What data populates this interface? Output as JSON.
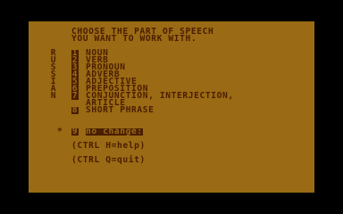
{
  "header": {
    "line1": "CHOOSE THE PART OF SPEECH",
    "line2": "YOU WANT TO WORK WITH."
  },
  "side_letters": [
    "R",
    "U",
    "S",
    "S",
    "I",
    "A",
    "N"
  ],
  "menu": [
    {
      "num": "1",
      "label": "NOUN"
    },
    {
      "num": "2",
      "label": "VERB"
    },
    {
      "num": "3",
      "label": "PRONOUN"
    },
    {
      "num": "4",
      "label": "ADVERB"
    },
    {
      "num": "5",
      "label": "ADJECTIVE"
    },
    {
      "num": "6",
      "label": "PREPOSITION"
    },
    {
      "num": "7",
      "label": "CONJUNCTION, INTERJECTION,",
      "label2": "ARTICLE"
    },
    {
      "num": "8",
      "label": "SHORT PHRASE"
    }
  ],
  "prompt": {
    "marker": "*",
    "num": "9",
    "text": "no change:"
  },
  "help_line": "(CTRL H=help)",
  "quit_line": "(CTRL Q=quit)",
  "colors": {
    "border": "#000000",
    "background": "#9a6a14",
    "foreground": "#4a1e00"
  }
}
